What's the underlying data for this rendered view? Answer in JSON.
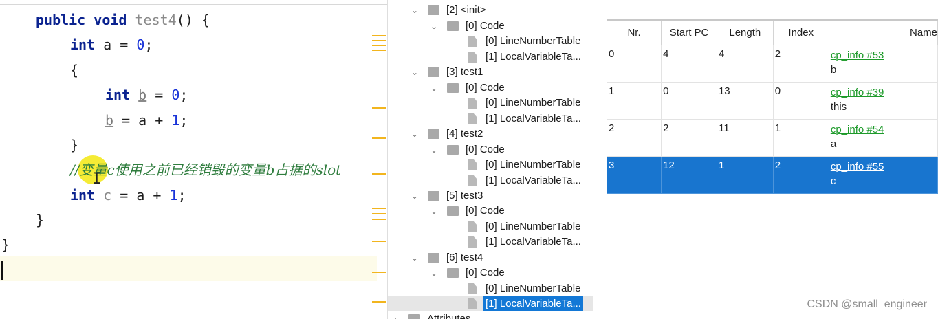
{
  "editor": {
    "code": {
      "kw_public": "public",
      "kw_void": "void",
      "method_name": "test4",
      "method_sig_rest": "() {",
      "kw_int": "int",
      "var_a": "a",
      "op_assign": " = ",
      "zero": "0",
      "semi": ";",
      "open_brace": "{",
      "var_b": "b",
      "plus_expr": " = a + ",
      "one": "1",
      "close_brace": "}",
      "comment": "//变量c使用之前已经销毁的变量b占据的slot",
      "var_c": "c"
    }
  },
  "tree": {
    "items": [
      {
        "label": "[2] <init>"
      },
      {
        "label": "[0] Code"
      },
      {
        "label": "[0] LineNumberTable"
      },
      {
        "label": "[1] LocalVariableTa..."
      },
      {
        "label": "[3] test1"
      },
      {
        "label": "[0] Code"
      },
      {
        "label": "[0] LineNumberTable"
      },
      {
        "label": "[1] LocalVariableTa..."
      },
      {
        "label": "[4] test2"
      },
      {
        "label": "[0] Code"
      },
      {
        "label": "[0] LineNumberTable"
      },
      {
        "label": "[1] LocalVariableTa..."
      },
      {
        "label": "[5] test3"
      },
      {
        "label": "[0] Code"
      },
      {
        "label": "[0] LineNumberTable"
      },
      {
        "label": "[1] LocalVariableTa..."
      },
      {
        "label": "[6] test4"
      },
      {
        "label": "[0] Code"
      },
      {
        "label": "[0] LineNumberTable"
      },
      {
        "label": "[1] LocalVariableTa..."
      },
      {
        "label": "Attributes"
      }
    ],
    "selected_index": 19,
    "folder_icon": "folder-icon",
    "file_icon": "document-icon",
    "toggle_icon": "chevron-down-icon"
  },
  "table": {
    "headers": [
      "Nr.",
      "Start PC",
      "Length",
      "Index",
      "Name"
    ],
    "rows": [
      {
        "nr": "0",
        "start_pc": "4",
        "length": "4",
        "index": "2",
        "name_link": "cp_info #53",
        "name": "b"
      },
      {
        "nr": "1",
        "start_pc": "0",
        "length": "13",
        "index": "0",
        "name_link": "cp_info #39",
        "name": "this"
      },
      {
        "nr": "2",
        "start_pc": "2",
        "length": "11",
        "index": "1",
        "name_link": "cp_info #54",
        "name": "a"
      },
      {
        "nr": "3",
        "start_pc": "12",
        "length": "1",
        "index": "2",
        "name_link": "cp_info #55",
        "name": "c"
      }
    ],
    "selected_row": 3
  },
  "watermark": "CSDN @small_engineer",
  "colors": {
    "keyword": "#0b2390",
    "comment": "#2f7d3e",
    "selection": "#1875cf",
    "link": "#1d9a2a"
  }
}
